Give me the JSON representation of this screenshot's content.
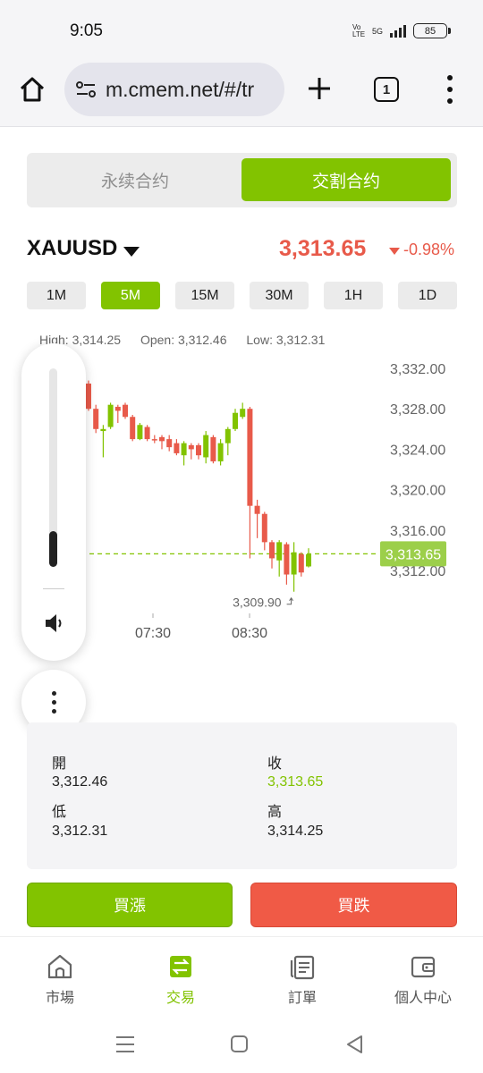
{
  "status_bar": {
    "time": "9:05",
    "network": "5G",
    "volte": "Vo LTE",
    "battery": "85"
  },
  "browser": {
    "url": "m.cmem.net/#/tr",
    "tab_count": "1"
  },
  "contract_tabs": [
    {
      "label": "永续合约",
      "active": false
    },
    {
      "label": "交割合约",
      "active": true
    }
  ],
  "ticker": {
    "symbol": "XAUUSD",
    "price": "3,313.65",
    "change": "-0.98%"
  },
  "intervals": [
    {
      "label": "1M",
      "active": false
    },
    {
      "label": "5M",
      "active": true
    },
    {
      "label": "15M",
      "active": false
    },
    {
      "label": "30M",
      "active": false
    },
    {
      "label": "1H",
      "active": false
    },
    {
      "label": "1D",
      "active": false
    }
  ],
  "ohlc_header": {
    "high": "High: 3,314.25",
    "open": "Open: 3,312.46",
    "low": "Low: 3,312.31"
  },
  "chart_data": {
    "type": "candlestick",
    "y_ticks": [
      "3,332.00",
      "3,328.00",
      "3,324.00",
      "3,320.00",
      "3,316.00",
      "3,312.00"
    ],
    "y_tick_values": [
      3332,
      3328,
      3324,
      3320,
      3316,
      3312
    ],
    "x_ticks": [
      "07:30",
      "08:30"
    ],
    "current_price_label": "3,313.65",
    "current_price": 3313.65,
    "low_marker_label": "3,309.90",
    "low_marker": 3309.9,
    "candles": [
      {
        "o": 3330.5,
        "c": 3328.0,
        "h": 3330.8,
        "l": 3327.8
      },
      {
        "o": 3328.0,
        "c": 3326.0,
        "h": 3328.4,
        "l": 3325.6
      },
      {
        "o": 3325.8,
        "c": 3326.0,
        "h": 3326.4,
        "l": 3323.2
      },
      {
        "o": 3326.2,
        "c": 3328.4,
        "h": 3328.6,
        "l": 3326.0
      },
      {
        "o": 3328.2,
        "c": 3327.8,
        "h": 3328.4,
        "l": 3326.6
      },
      {
        "o": 3328.4,
        "c": 3327.2,
        "h": 3328.6,
        "l": 3327.0
      },
      {
        "o": 3327.2,
        "c": 3325.0,
        "h": 3327.4,
        "l": 3324.8
      },
      {
        "o": 3325.0,
        "c": 3326.4,
        "h": 3326.6,
        "l": 3324.9
      },
      {
        "o": 3326.2,
        "c": 3325.0,
        "h": 3326.4,
        "l": 3324.8
      },
      {
        "o": 3325.0,
        "c": 3324.9,
        "h": 3325.4,
        "l": 3324.6
      },
      {
        "o": 3325.2,
        "c": 3324.8,
        "h": 3325.4,
        "l": 3324.0
      },
      {
        "o": 3325.0,
        "c": 3324.2,
        "h": 3325.4,
        "l": 3323.8
      },
      {
        "o": 3324.6,
        "c": 3323.6,
        "h": 3325.0,
        "l": 3323.4
      },
      {
        "o": 3323.4,
        "c": 3324.6,
        "h": 3324.8,
        "l": 3322.4
      },
      {
        "o": 3324.4,
        "c": 3324.0,
        "h": 3324.6,
        "l": 3323.0
      },
      {
        "o": 3324.4,
        "c": 3323.4,
        "h": 3324.6,
        "l": 3323.0
      },
      {
        "o": 3323.2,
        "c": 3325.4,
        "h": 3325.8,
        "l": 3322.6
      },
      {
        "o": 3325.2,
        "c": 3322.8,
        "h": 3325.4,
        "l": 3322.6
      },
      {
        "o": 3322.8,
        "c": 3324.6,
        "h": 3325.0,
        "l": 3322.4
      },
      {
        "o": 3324.6,
        "c": 3326.0,
        "h": 3326.2,
        "l": 3323.4
      },
      {
        "o": 3326.0,
        "c": 3327.6,
        "h": 3328.0,
        "l": 3325.8
      },
      {
        "o": 3327.2,
        "c": 3328.0,
        "h": 3328.6,
        "l": 3327.0
      },
      {
        "o": 3328.0,
        "c": 3318.4,
        "h": 3328.2,
        "l": 3313.2
      },
      {
        "o": 3318.4,
        "c": 3317.6,
        "h": 3319.0,
        "l": 3315.2
      },
      {
        "o": 3317.6,
        "c": 3314.8,
        "h": 3317.8,
        "l": 3314.0
      },
      {
        "o": 3314.8,
        "c": 3313.2,
        "h": 3315.0,
        "l": 3312.2
      },
      {
        "o": 3313.0,
        "c": 3314.8,
        "h": 3315.0,
        "l": 3311.4
      },
      {
        "o": 3314.6,
        "c": 3311.6,
        "h": 3314.8,
        "l": 3310.6
      },
      {
        "o": 3311.6,
        "c": 3313.8,
        "h": 3314.8,
        "l": 3309.9
      },
      {
        "o": 3313.6,
        "c": 3311.8,
        "h": 3313.8,
        "l": 3311.4
      },
      {
        "o": 3312.4,
        "c": 3313.6,
        "h": 3314.2,
        "l": 3312.3
      }
    ]
  },
  "stats": {
    "open_label": "開",
    "open_value": "3,312.46",
    "close_label": "收",
    "close_value": "3,313.65",
    "low_label": "低",
    "low_value": "3,312.31",
    "high_label": "高",
    "high_value": "3,314.25"
  },
  "volume": {
    "level": 0.18
  },
  "actions": {
    "buy_label": "買漲",
    "sell_label": "買跌"
  },
  "bottom_nav": [
    {
      "label": "市場",
      "icon": "home-icon",
      "active": false
    },
    {
      "label": "交易",
      "icon": "swap-icon",
      "active": true
    },
    {
      "label": "訂單",
      "icon": "orders-icon",
      "active": false
    },
    {
      "label": "個人中心",
      "icon": "wallet-icon",
      "active": false
    }
  ],
  "colors": {
    "green": "#82c300",
    "red": "#e85a4a"
  }
}
